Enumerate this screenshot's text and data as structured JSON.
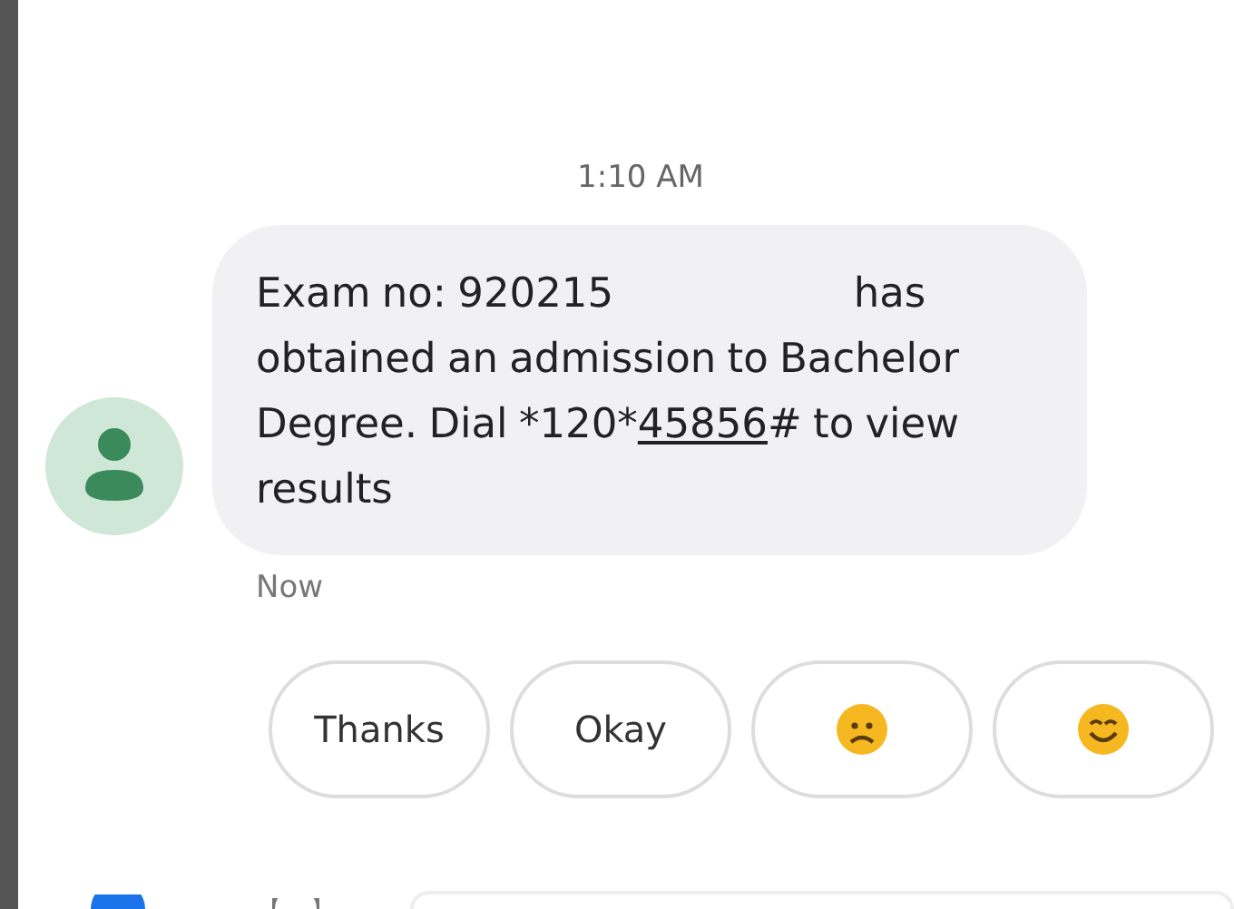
{
  "timestamp": "1:10 AM",
  "message": {
    "parts": [
      {
        "kind": "text",
        "text": "Exam no: 920215"
      },
      {
        "kind": "gap"
      },
      {
        "kind": "text",
        "text": "has obtained an admission to Bachelor Degree. Dial *120*"
      },
      {
        "kind": "link",
        "text": "45856"
      },
      {
        "kind": "text",
        "text": "# to view results"
      }
    ],
    "time": "Now"
  },
  "suggestions": [
    {
      "kind": "text",
      "label": "Thanks"
    },
    {
      "kind": "text",
      "label": "Okay"
    },
    {
      "kind": "frown"
    },
    {
      "kind": "smile"
    }
  ]
}
